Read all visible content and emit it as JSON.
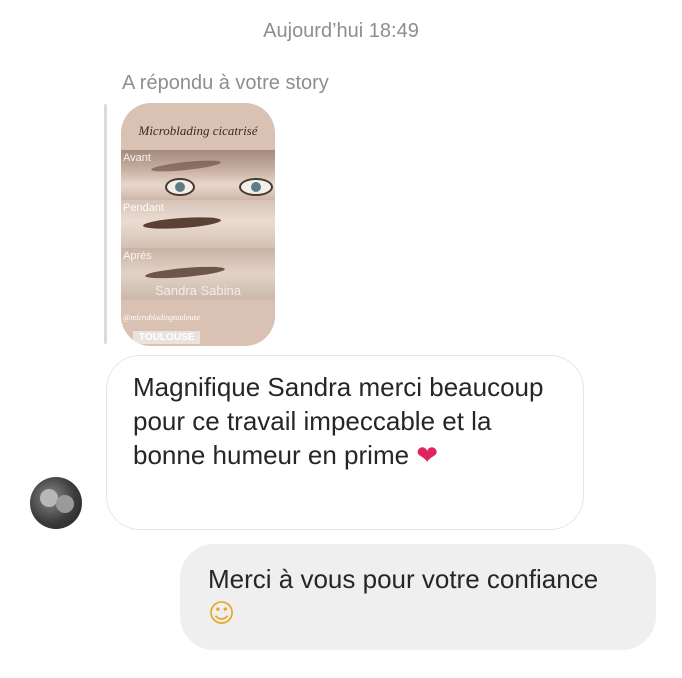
{
  "timestamp": "Aujourd’hui 18:49",
  "reply": {
    "label": "A répondu à votre story"
  },
  "story": {
    "title": "Microblading cicatrisé",
    "bands": [
      "Avant",
      "Pendant",
      "Après"
    ],
    "watermark": "Sandra Sabina",
    "handle": "@microbladingtoulouse",
    "city": "TOULOUSE"
  },
  "messages": {
    "incoming": {
      "text": "Magnifique Sandra merci beaucoup pour ce travail impeccable et la bonne humeur en prime",
      "emoji": "❤"
    },
    "outgoing": {
      "text": "Merci à vous pour votre confiance",
      "emoji": "☺"
    }
  },
  "colors": {
    "meta_text": "#8e8e8e",
    "outgoing_bubble": "#efefef",
    "incoming_border": "#e6e6e6"
  },
  "icons": {
    "heart": "red-heart-icon",
    "smile": "smiling-face-icon"
  }
}
